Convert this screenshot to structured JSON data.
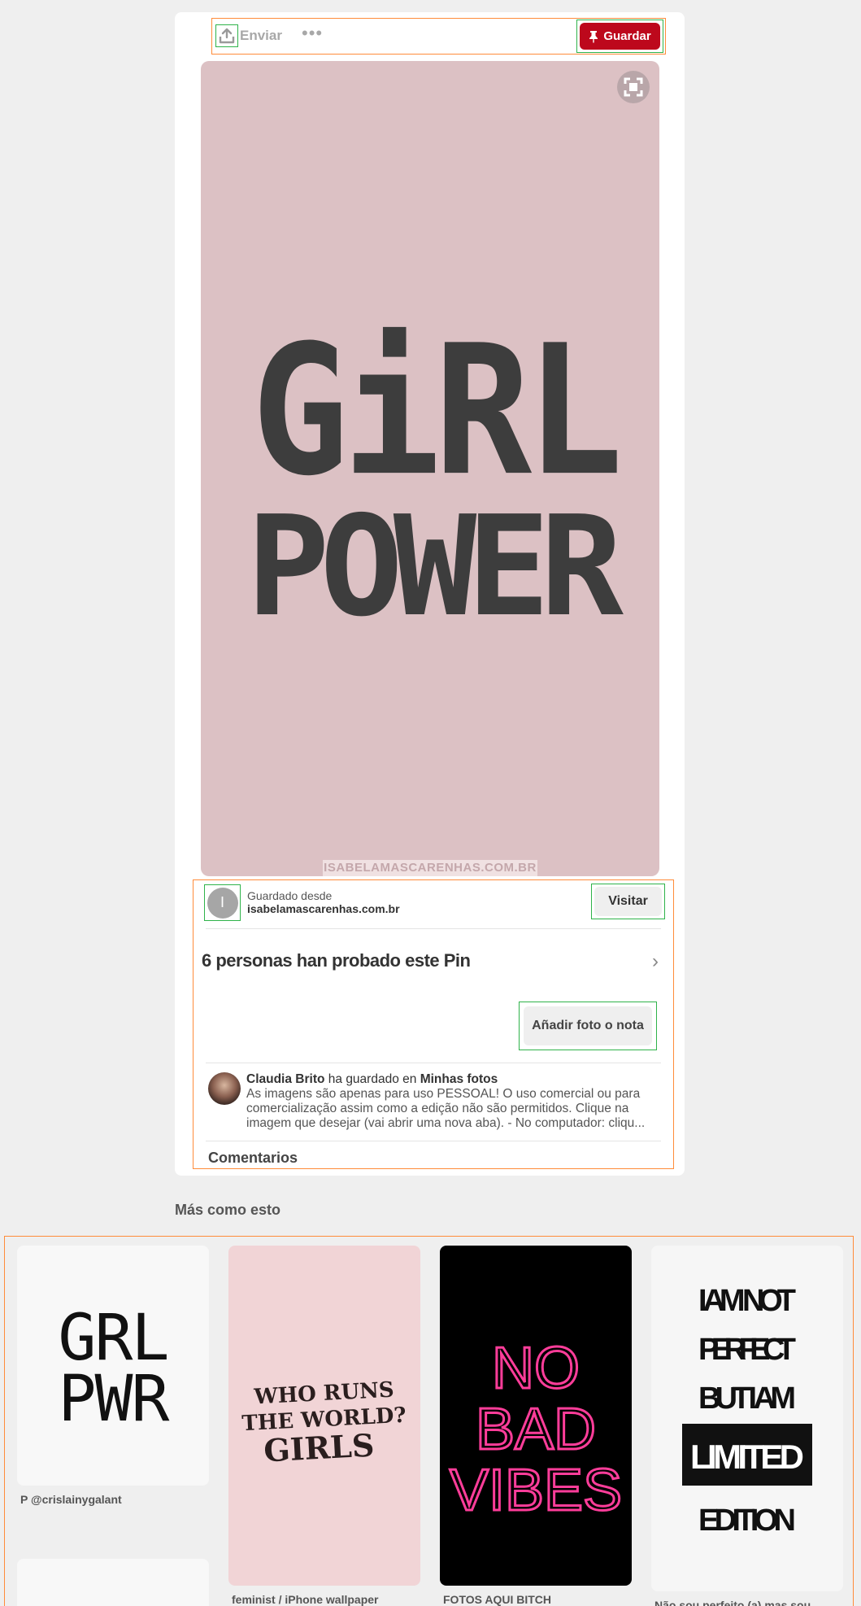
{
  "toolbar": {
    "send_label": "Enviar",
    "more_label": "•••",
    "save_label": "Guardar"
  },
  "pin": {
    "art_line1": "GiRL",
    "art_line2": "POWER",
    "watermark": "ISABELAMASCARENHAS.COM.BR",
    "bg_color": "#dcc1c4"
  },
  "source": {
    "avatar_initial": "I",
    "saved_from_label": "Guardado desde",
    "domain": "isabelamascarenhas.com.br",
    "visit_label": "Visitar"
  },
  "tried": {
    "title": "6 personas han probado este Pin",
    "add_photo_label": "Añadir foto o nota"
  },
  "activity": {
    "user": "Claudia Brito",
    "action": "ha guardado en",
    "board": "Minhas fotos",
    "description": "As imagens são apenas para uso PESSOAL! O uso comercial ou para comercialização assim como a edição não são permitidos. Clique na imagem que desejar (vai abrir uma nova aba). - No computador: cliqu..."
  },
  "comments_label": "Comentarios",
  "more_like_this": {
    "title": "Más como esto",
    "tiles": [
      {
        "art": [
          "GRL",
          "PWR"
        ],
        "caption": "P @crislainygalant"
      },
      {
        "art": [
          "WHO RUNS",
          "THE WORLD?",
          "GIRLS"
        ],
        "caption": "feminist / iPhone wallpaper"
      },
      {
        "art": [
          "NO",
          "BAD",
          "VIBES"
        ],
        "caption": "FOTOS AQUI BITCH"
      },
      {
        "art": [
          "I AM NOT",
          "PERFECT",
          "BUT I AM",
          "LIMITED",
          "EDITION"
        ],
        "caption": "Não sou perfeito (a) mas sou"
      }
    ]
  },
  "colors": {
    "brand_red": "#bd081c",
    "annotation_orange": "#ff8c3a",
    "annotation_green": "#2fb34a"
  }
}
